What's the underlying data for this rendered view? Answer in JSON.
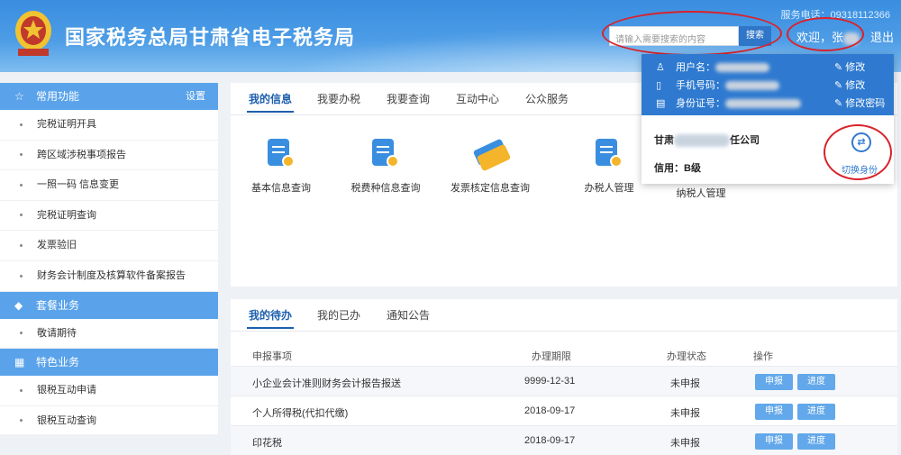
{
  "header": {
    "title": "国家税务总局甘肃省电子税务局",
    "hotline": "服务电话：09318112366",
    "search_placeholder": "请输入需要搜索的内容",
    "search_label": "搜索",
    "welcome": "欢迎，张",
    "logout": "退出",
    "colors": {
      "header_bg": "#3a8ee0",
      "accent": "#1d5fae",
      "highlight_ring": "#d9222a"
    }
  },
  "sidebar": {
    "common": {
      "title": "常用功能",
      "settings": "设置",
      "items": [
        "完税证明开具",
        "跨区域涉税事项报告",
        "一照一码 信息变更",
        "完税证明查询",
        "发票验旧",
        "财务会计制度及核算软件备案报告"
      ]
    },
    "package": {
      "title": "套餐业务",
      "items": [
        "敬请期待"
      ]
    },
    "special": {
      "title": "特色业务",
      "items": [
        "银税互动申请",
        "银税互动查询"
      ]
    }
  },
  "info_panel": {
    "tabs": [
      "我的信息",
      "我要办税",
      "我要查询",
      "互动中心",
      "公众服务"
    ],
    "functions": [
      "基本信息查询",
      "税费种信息查询",
      "发票核定信息查询",
      "办税人管理",
      "纳税人管理"
    ]
  },
  "dropdown": {
    "username_label": "用户名：",
    "phone_label": "手机号码：",
    "idcard_label": "身份证号：",
    "edit": "修改",
    "edit_password": "修改密码",
    "company_prefix": "甘肃",
    "company_suffix": "任公司",
    "credit": "信用：B级",
    "switch_label": "切换身份"
  },
  "todo_panel": {
    "tabs": [
      "我的待办",
      "我的已办",
      "通知公告"
    ],
    "columns": [
      "申报事项",
      "办理期限",
      "办理状态",
      "操作"
    ],
    "rows": [
      {
        "item": "小企业会计准则财务会计报告报送",
        "deadline": "9999-12-31",
        "status": "未申报"
      },
      {
        "item": "个人所得税(代扣代缴)",
        "deadline": "2018-09-17",
        "status": "未申报"
      },
      {
        "item": "印花税",
        "deadline": "2018-09-17",
        "status": "未申报"
      }
    ],
    "action_declare": "申报",
    "action_progress": "进度"
  }
}
